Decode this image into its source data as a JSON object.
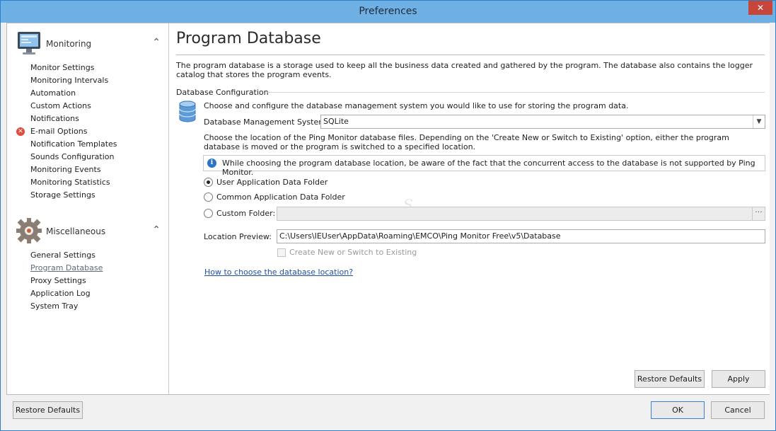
{
  "window": {
    "title": "Preferences",
    "close_glyph": "✕"
  },
  "sidebar": {
    "groups": [
      {
        "title": "Monitoring",
        "icon": "monitor-icon",
        "items": [
          {
            "label": "Monitor Settings"
          },
          {
            "label": "Monitoring Intervals"
          },
          {
            "label": "Automation"
          },
          {
            "label": "Custom Actions"
          },
          {
            "label": "Notifications"
          },
          {
            "label": "E-mail Options",
            "error": true
          },
          {
            "label": "Notification Templates"
          },
          {
            "label": "Sounds Configuration"
          },
          {
            "label": "Monitoring Events"
          },
          {
            "label": "Monitoring Statistics"
          },
          {
            "label": "Storage Settings"
          }
        ]
      },
      {
        "title": "Miscellaneous",
        "icon": "gear-icon",
        "items": [
          {
            "label": "General Settings"
          },
          {
            "label": "Program Database",
            "active": true
          },
          {
            "label": "Proxy Settings"
          },
          {
            "label": "Application Log"
          },
          {
            "label": "System Tray"
          }
        ]
      }
    ]
  },
  "page": {
    "title": "Program Database",
    "description": "The program database is a storage used to keep all the business data created and gathered by the program. The database also contains the logger catalog that stores the program events.",
    "section": "Database Configuration",
    "choose_text": "Choose and configure the database management system you would like to use for storing the program data.",
    "dbms_label": "Database Management System:",
    "dbms_value": "SQLite",
    "location_text": "Choose the location of the Ping Monitor database files. Depending on the 'Create New or Switch to Existing' option, either the program database is moved or the program is switched to a specified location.",
    "info_text": "While choosing the program database location, be aware of the fact that the concurrent access to the database is not supported by Ping Monitor.",
    "radio_user": "User Application Data Folder",
    "radio_common": "Common Application Data Folder",
    "radio_custom": "Custom Folder:",
    "custom_folder_value": "",
    "browse_glyph": "···",
    "preview_label": "Location Preview:",
    "preview_value": "C:\\Users\\IEUser\\AppData\\Roaming\\EMCO\\Ping Monitor Free\\v5\\Database",
    "create_switch_label": "Create New or Switch to Existing",
    "help_link": "How to choose the database location?",
    "restore_defaults": "Restore Defaults",
    "apply": "Apply"
  },
  "footer": {
    "restore_defaults": "Restore Defaults",
    "ok": "OK",
    "cancel": "Cancel"
  }
}
